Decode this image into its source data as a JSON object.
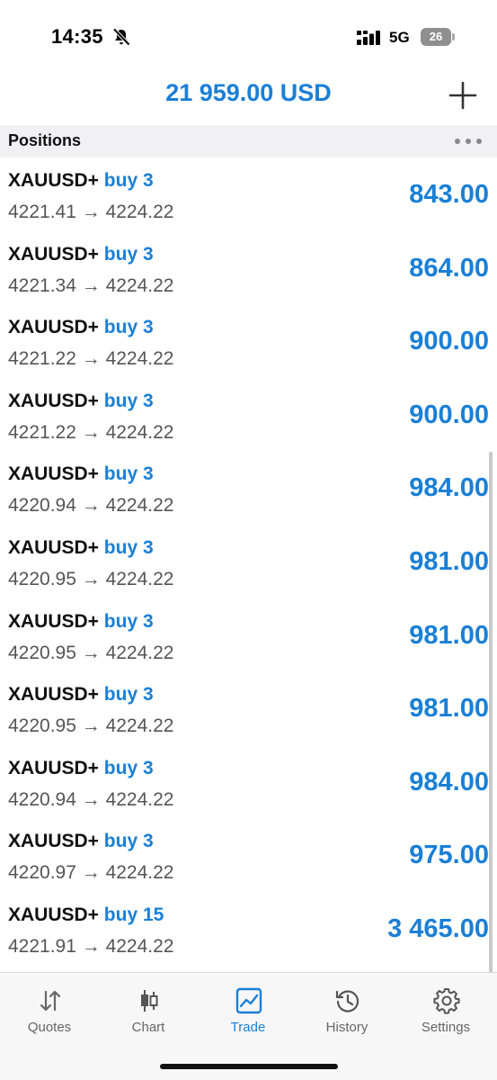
{
  "status_bar": {
    "time": "14:35",
    "network": "5G",
    "battery": "26"
  },
  "header": {
    "balance": "21 959.00 USD"
  },
  "section": {
    "title": "Positions"
  },
  "positions": [
    {
      "symbol": "XAUUSD+",
      "type": "buy 3",
      "prices": "4221.41 → 4224.22",
      "profit": "843.00"
    },
    {
      "symbol": "XAUUSD+",
      "type": "buy 3",
      "prices": "4221.34 → 4224.22",
      "profit": "864.00"
    },
    {
      "symbol": "XAUUSD+",
      "type": "buy 3",
      "prices": "4221.22 → 4224.22",
      "profit": "900.00"
    },
    {
      "symbol": "XAUUSD+",
      "type": "buy 3",
      "prices": "4221.22 → 4224.22",
      "profit": "900.00"
    },
    {
      "symbol": "XAUUSD+",
      "type": "buy 3",
      "prices": "4220.94 → 4224.22",
      "profit": "984.00"
    },
    {
      "symbol": "XAUUSD+",
      "type": "buy 3",
      "prices": "4220.95 → 4224.22",
      "profit": "981.00"
    },
    {
      "symbol": "XAUUSD+",
      "type": "buy 3",
      "prices": "4220.95 → 4224.22",
      "profit": "981.00"
    },
    {
      "symbol": "XAUUSD+",
      "type": "buy 3",
      "prices": "4220.95 → 4224.22",
      "profit": "981.00"
    },
    {
      "symbol": "XAUUSD+",
      "type": "buy 3",
      "prices": "4220.94 → 4224.22",
      "profit": "984.00"
    },
    {
      "symbol": "XAUUSD+",
      "type": "buy 3",
      "prices": "4220.97 → 4224.22",
      "profit": "975.00"
    },
    {
      "symbol": "XAUUSD+",
      "type": "buy 15",
      "prices": "4221.91 → 4224.22",
      "profit": "3 465.00"
    }
  ],
  "tabs": [
    {
      "label": "Quotes",
      "icon": "quotes-arrows-icon",
      "active": false
    },
    {
      "label": "Chart",
      "icon": "candlestick-icon",
      "active": false
    },
    {
      "label": "Trade",
      "icon": "trade-chart-icon",
      "active": true
    },
    {
      "label": "History",
      "icon": "history-clock-icon",
      "active": false
    },
    {
      "label": "Settings",
      "icon": "gear-icon",
      "active": false
    }
  ],
  "colors": {
    "accent": "#1a7fd6",
    "section_background": "#f1f1f3",
    "inactive_tab": "#666666"
  }
}
